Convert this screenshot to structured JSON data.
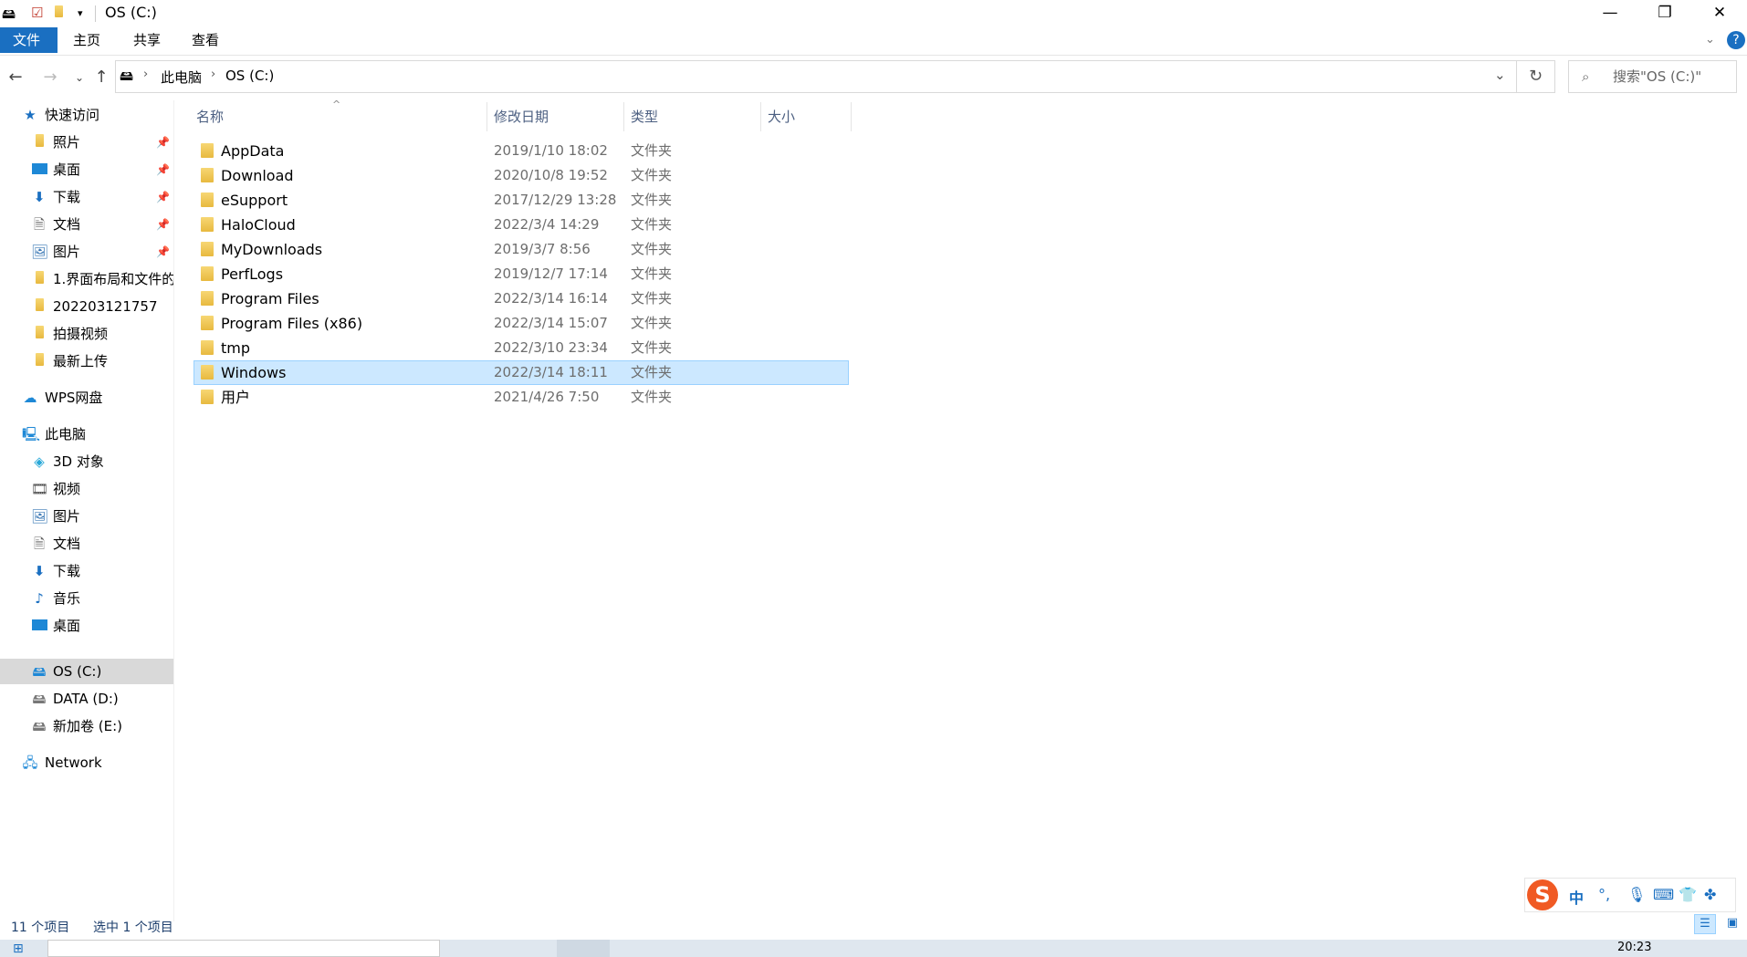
{
  "window": {
    "title": "OS (C:)",
    "controls": {
      "minimize": "—",
      "maximize": "❐",
      "close": "✕"
    }
  },
  "ribbon": {
    "tabs": [
      "文件",
      "主页",
      "共享",
      "查看"
    ],
    "help": "?"
  },
  "address": {
    "path": [
      "此电脑",
      "OS (C:)"
    ],
    "search_placeholder": "搜索\"OS (C:)\""
  },
  "sidebar": {
    "quick_access": "快速访问",
    "quick_items": [
      "照片",
      "桌面",
      "下载",
      "文档",
      "图片",
      "1.界面布局和文件的",
      "202203121757",
      "拍摄视频",
      "最新上传"
    ],
    "wps": "WPS网盘",
    "this_pc": "此电脑",
    "pc_items": [
      "3D 对象",
      "视频",
      "图片",
      "文档",
      "下载",
      "音乐",
      "桌面",
      "OS (C:)",
      "DATA (D:)",
      "新加卷 (E:)"
    ],
    "network": "Network"
  },
  "columns": {
    "name": "名称",
    "date": "修改日期",
    "type": "类型",
    "size": "大小"
  },
  "files": [
    {
      "name": "AppData",
      "date": "2019/1/10 18:02",
      "type": "文件夹"
    },
    {
      "name": "Download",
      "date": "2020/10/8 19:52",
      "type": "文件夹"
    },
    {
      "name": "eSupport",
      "date": "2017/12/29 13:28",
      "type": "文件夹"
    },
    {
      "name": "HaloCloud",
      "date": "2022/3/4 14:29",
      "type": "文件夹"
    },
    {
      "name": "MyDownloads",
      "date": "2019/3/7 8:56",
      "type": "文件夹"
    },
    {
      "name": "PerfLogs",
      "date": "2019/12/7 17:14",
      "type": "文件夹"
    },
    {
      "name": "Program Files",
      "date": "2022/3/14 16:14",
      "type": "文件夹"
    },
    {
      "name": "Program Files (x86)",
      "date": "2022/3/14 15:07",
      "type": "文件夹"
    },
    {
      "name": "tmp",
      "date": "2022/3/10 23:34",
      "type": "文件夹"
    },
    {
      "name": "Windows",
      "date": "2022/3/14 18:11",
      "type": "文件夹"
    },
    {
      "name": "用户",
      "date": "2021/4/26 7:50",
      "type": "文件夹"
    }
  ],
  "status": {
    "count": "11 个项目",
    "selected": "选中 1 个项目"
  },
  "ime": {
    "logo": "S",
    "lang": "中",
    "punct": "°,"
  },
  "taskbar": {
    "time": "20:23"
  }
}
